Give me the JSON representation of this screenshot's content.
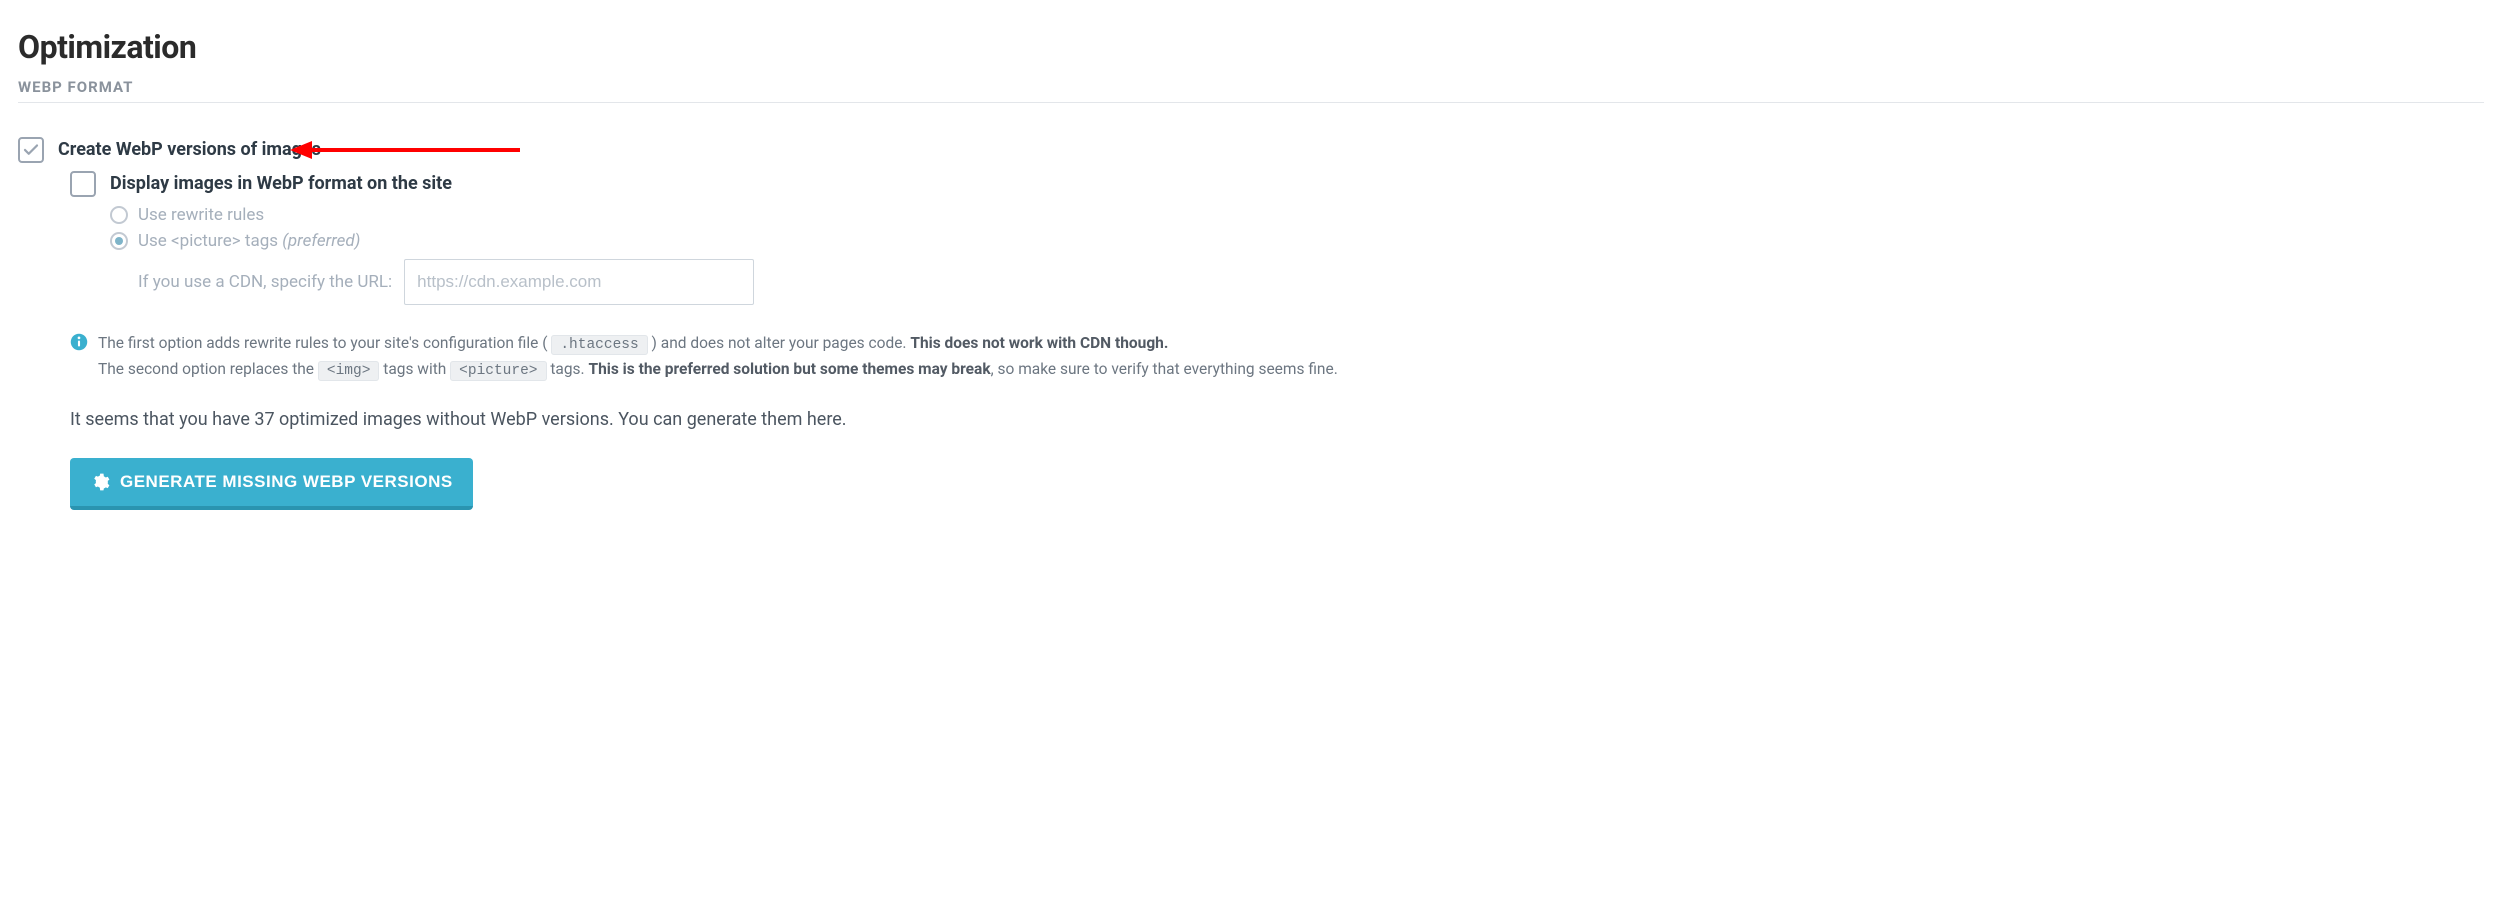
{
  "page": {
    "title": "Optimization",
    "section": "WEBP FORMAT"
  },
  "options": {
    "create_webp": {
      "label": "Create WebP versions of images",
      "checked": true
    },
    "display_webp": {
      "label": "Display images in WebP format on the site",
      "checked": false,
      "methods": {
        "rewrite": {
          "label": "Use rewrite rules",
          "selected": false
        },
        "picture": {
          "label_prefix": "Use <picture> tags ",
          "label_suffix": "(preferred)",
          "selected": true
        }
      },
      "cdn": {
        "label": "If you use a CDN, specify the URL:",
        "placeholder": "https://cdn.example.com",
        "value": ""
      }
    }
  },
  "help": {
    "line1_a": "The first option adds rewrite rules to your site's configuration file ( ",
    "code1": ".htaccess",
    "line1_b": " ) and does not alter your pages code. ",
    "line1_strong": "This does not work with CDN though.",
    "line2_a": "The second option replaces the ",
    "code2": "<img>",
    "line2_b": " tags with ",
    "code3": "<picture>",
    "line2_c": " tags. ",
    "line2_strong": "This is the preferred solution but some themes may break",
    "line2_d": ", so make sure to verify that everything seems fine."
  },
  "status": {
    "text": "It seems that you have 37 optimized images without WebP versions. You can generate them here.",
    "missing_count": 37
  },
  "actions": {
    "generate_label": "GENERATE MISSING WEBP VERSIONS"
  },
  "annotation": {
    "arrow_color": "#ff0000"
  }
}
